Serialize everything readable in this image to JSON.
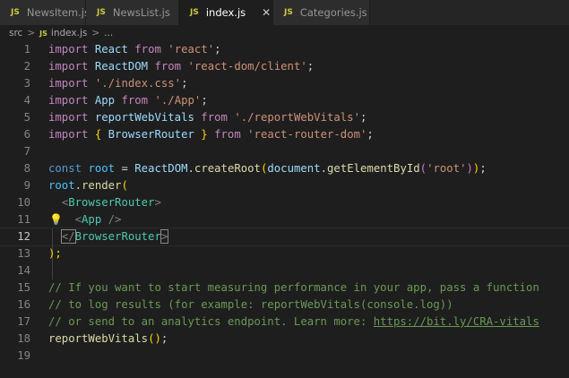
{
  "tabs": [
    {
      "icon": "JS",
      "label": "NewsItem.js",
      "active": false
    },
    {
      "icon": "JS",
      "label": "NewsList.js",
      "active": false
    },
    {
      "icon": "JS",
      "label": "index.js",
      "active": true
    },
    {
      "icon": "JS",
      "label": "Categories.js",
      "active": false
    }
  ],
  "close_glyph": "✕",
  "breadcrumb": {
    "folder": "src",
    "sep": ">",
    "icon": "JS",
    "file": "index.js",
    "more": "..."
  },
  "lines": {
    "n1": "1",
    "n2": "2",
    "n3": "3",
    "n4": "4",
    "n5": "5",
    "n6": "6",
    "n7": "7",
    "n8": "8",
    "n9": "9",
    "n10": "10",
    "n11": "11",
    "n12": "12",
    "n13": "13",
    "n14": "14",
    "n15": "15",
    "n16": "16",
    "n17": "17",
    "n18": "18",
    "n19": "19"
  },
  "code": {
    "import": "import",
    "from": "from",
    "const": "const",
    "react_id": "React",
    "react_str": "'react'",
    "reactdom_id": "ReactDOM",
    "reactdom_str": "'react-dom/client'",
    "css_str": "'./index.css'",
    "app_id": "App",
    "app_str": "'./App'",
    "rwv_id": "reportWebVitals",
    "rwv_str": "'./reportWebVitals'",
    "lbrace": "{",
    "rbrace": "}",
    "browserrouter_id": "BrowserRouter",
    "router_str": "'react-router-dom'",
    "root_id": "root",
    "equals": "=",
    "createRoot": "createRoot",
    "document": "document",
    "getElementById": "getElementById",
    "root_str": "'root'",
    "render": "render",
    "dot": ".",
    "semi": ";",
    "lparen": "(",
    "rparen": ")",
    "lt": "<",
    "gt": ">",
    "lt_slash": "</",
    "self_close": "/>",
    "close_call": ");",
    "comment1": "// If you want to start measuring performance in your app, pass a function",
    "comment2": "// to log results (for example: reportWebVitals(console.log))",
    "comment3": "// or send to an analytics endpoint. Learn more: ",
    "link": "https://bit.ly/CRA-vitals",
    "call_parens": "()",
    "bulb": "💡"
  }
}
